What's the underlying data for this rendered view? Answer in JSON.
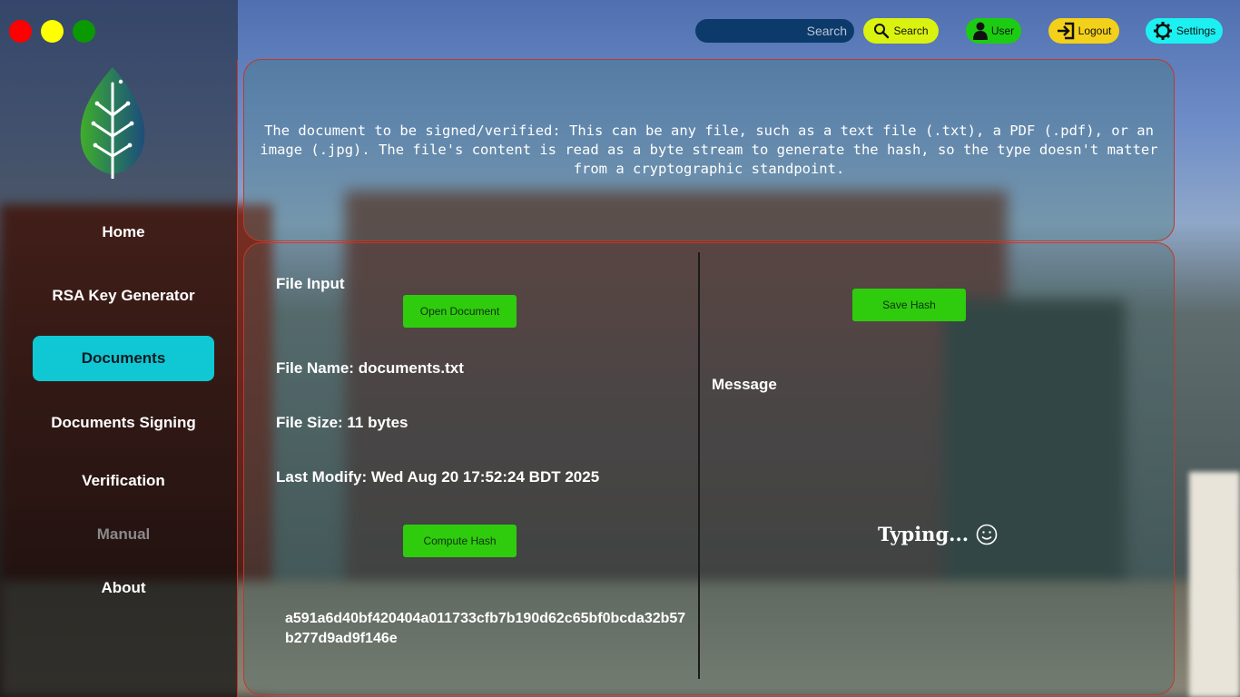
{
  "window_controls": [
    "close",
    "minimize",
    "maximize"
  ],
  "topbar": {
    "search_placeholder": "Search",
    "search_button": "Search",
    "user_button": "User",
    "logout_button": "Logout",
    "settings_button": "Settings"
  },
  "sidebar": {
    "items": [
      {
        "label": "Home"
      },
      {
        "label": "RSA Key Generator"
      },
      {
        "label": "Documents",
        "active": true
      },
      {
        "label": "Documents Signing"
      },
      {
        "label": "Verification"
      },
      {
        "label": "Manual",
        "disabled": true
      },
      {
        "label": "About"
      }
    ]
  },
  "info": {
    "text": "The document to be signed/verified: This can be any file, such as a text file (.txt), a PDF (.pdf), or an image (.jpg). The file's content is read as a byte stream to generate the hash, so the type doesn't matter from a cryptographic standpoint."
  },
  "file": {
    "input_label": "File Input",
    "open_button": "Open Document",
    "name_line": "File Name: documents.txt",
    "size_line": "File Size: 11 bytes",
    "modified_line": "Last Modify: Wed Aug 20 17:52:24 BDT 2025",
    "compute_button": "Compute Hash",
    "hash": "a591a6d40bf420404a011733cfb7b190d62c65bf0bcda32b57b277d9ad9f146e"
  },
  "right": {
    "save_button": "Save Hash",
    "message_label": "Message",
    "typing_text": "Typing..."
  },
  "colors": {
    "accent_cyan": "#10c8d3",
    "action_green": "#2fcc0d",
    "panel_border": "#c0392b"
  }
}
